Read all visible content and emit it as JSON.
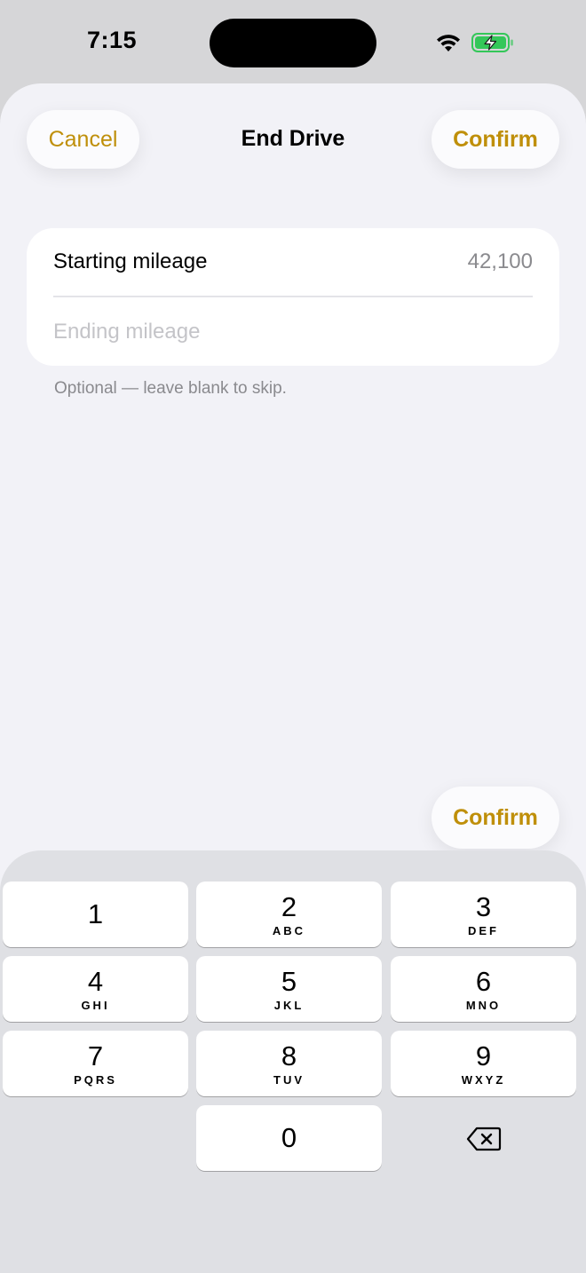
{
  "status_bar": {
    "time": "7:15",
    "icons": [
      "wifi-icon",
      "battery-charging-icon"
    ],
    "battery_color": "#34c759"
  },
  "header": {
    "cancel_label": "Cancel",
    "title": "End Drive",
    "confirm_label": "Confirm"
  },
  "form": {
    "starting_label": "Starting mileage",
    "starting_value": "42,100",
    "ending_placeholder": "Ending mileage",
    "ending_value": "",
    "helper": "Optional — leave blank to skip."
  },
  "footer": {
    "confirm_label": "Confirm"
  },
  "keyboard": {
    "keys": [
      {
        "digit": "1",
        "letters": ""
      },
      {
        "digit": "2",
        "letters": "ABC"
      },
      {
        "digit": "3",
        "letters": "DEF"
      },
      {
        "digit": "4",
        "letters": "GHI"
      },
      {
        "digit": "5",
        "letters": "JKL"
      },
      {
        "digit": "6",
        "letters": "MNO"
      },
      {
        "digit": "7",
        "letters": "PQRS"
      },
      {
        "digit": "8",
        "letters": "TUV"
      },
      {
        "digit": "9",
        "letters": "WXYZ"
      },
      {
        "digit": "0",
        "letters": ""
      }
    ],
    "delete_icon": "delete-backward-icon"
  },
  "colors": {
    "accent": "#bf8f0a",
    "sheet_background": "#f2f2f7",
    "keyboard_background": "#dfe0e4"
  }
}
